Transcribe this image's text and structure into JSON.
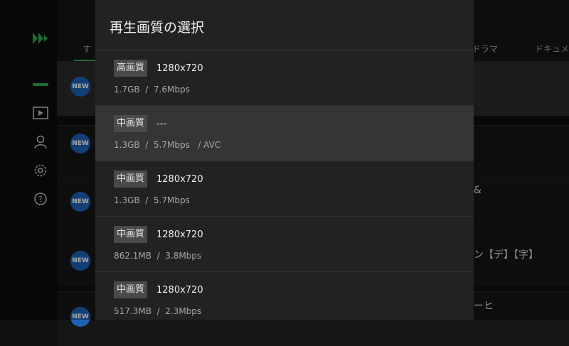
{
  "modal": {
    "title": "再生画質の選択",
    "options": [
      {
        "quality": "高画質",
        "resolution": "1280x720",
        "meta": "1.7GB  /  7.6Mbps"
      },
      {
        "quality": "中画質",
        "resolution": "---",
        "meta": "1.3GB  /  5.7Mbps   / AVC",
        "selected": true
      },
      {
        "quality": "中画質",
        "resolution": "1280x720",
        "meta": "1.3GB  /  5.7Mbps"
      },
      {
        "quality": "中画質",
        "resolution": "1280x720",
        "meta": "862.1MB  /  3.8Mbps"
      },
      {
        "quality": "中画質",
        "resolution": "1280x720",
        "meta": "517.3MB  /  2.3Mbps"
      }
    ]
  },
  "background": {
    "tabs": [
      "す",
      "ドラマ",
      "ドキュメ"
    ],
    "new_badge": "NEW",
    "row_texts": [
      "&",
      "ン【デ】【字】",
      "ーヒ"
    ]
  },
  "nav": {
    "icons": [
      "logo-icon",
      "home-icon",
      "play-icon",
      "user-icon",
      "settings-icon",
      "help-icon"
    ]
  },
  "colors": {
    "accent": "#2aa84a",
    "badge_blue": "#1d63b5",
    "modal_bg": "#222222",
    "selected_bg": "#353535"
  }
}
